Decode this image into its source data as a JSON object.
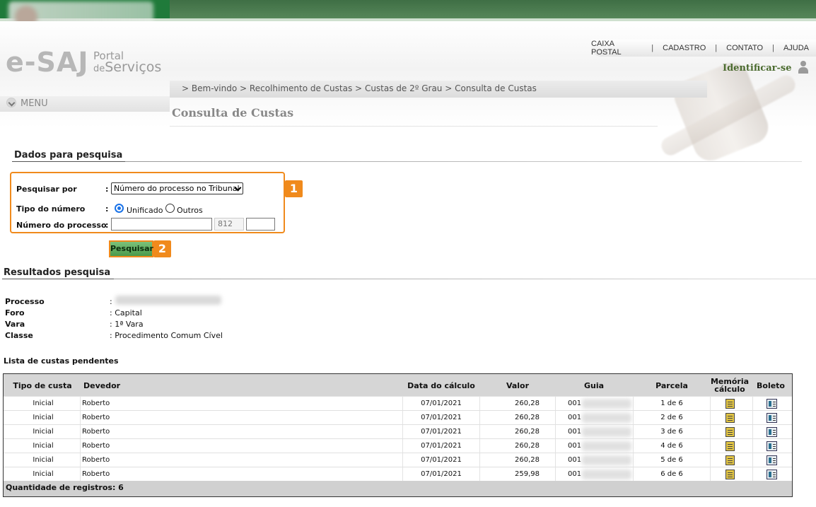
{
  "header": {
    "brand_esaj": "e-SAJ",
    "brand_portal": "Portal",
    "brand_de": "de",
    "brand_servicos": "Serviços",
    "nav": [
      "CAIXA POSTAL",
      "CADASTRO",
      "CONTATO",
      "AJUDA"
    ],
    "nav_separator": "|",
    "login_label": "Identificar-se",
    "menu_label": "MENU",
    "breadcrumb": [
      "Bem-vindo",
      "Recolhimento de Custas",
      "Custas de 2º Grau",
      "Consulta de Custas"
    ],
    "breadcrumb_sep": ">",
    "page_title": "Consulta de Custas"
  },
  "search": {
    "section_title": "Dados para pesquisa",
    "pesquisar_por_label": "Pesquisar por",
    "pesquisar_por_value": "Número do processo no Tribunal",
    "tipo_label": "Tipo do número",
    "tipo_options": [
      "Unificado",
      "Outros"
    ],
    "tipo_selected": "Unificado",
    "numero_label": "Número do processo",
    "numero_value": "",
    "numero_segment": "812",
    "numero_extra": "",
    "colon": ":",
    "button_label": "Pesquisar",
    "badge_1": "1",
    "badge_2": "2"
  },
  "results": {
    "section_title": "Resultados pesquisa",
    "fields": [
      {
        "label": "Processo",
        "value": ""
      },
      {
        "label": "Foro",
        "value": "Capital"
      },
      {
        "label": "Vara",
        "value": "1ª Vara"
      },
      {
        "label": "Classe",
        "value": "Procedimento Comum Cível"
      }
    ],
    "list_title": "Lista de custas pendentes"
  },
  "table": {
    "headers": {
      "tipo": "Tipo de custa",
      "devedor": "Devedor",
      "data": "Data do cálculo",
      "valor": "Valor",
      "guia": "Guia",
      "parcela": "Parcela",
      "memoria_1": "Memória",
      "memoria_2": "cálculo",
      "boleto": "Boleto"
    },
    "rows": [
      {
        "tipo": "Inicial",
        "devedor": "Roberto",
        "data": "07/01/2021",
        "valor": "260,28",
        "guia": "001",
        "parcela": "1 de 6"
      },
      {
        "tipo": "Inicial",
        "devedor": "Roberto",
        "data": "07/01/2021",
        "valor": "260,28",
        "guia": "001",
        "parcela": "2 de 6"
      },
      {
        "tipo": "Inicial",
        "devedor": "Roberto",
        "data": "07/01/2021",
        "valor": "260,28",
        "guia": "001",
        "parcela": "3 de 6"
      },
      {
        "tipo": "Inicial",
        "devedor": "Roberto",
        "data": "07/01/2021",
        "valor": "260,28",
        "guia": "001",
        "parcela": "4 de 6"
      },
      {
        "tipo": "Inicial",
        "devedor": "Roberto",
        "data": "07/01/2021",
        "valor": "260,28",
        "guia": "001",
        "parcela": "5 de 6"
      },
      {
        "tipo": "Inicial",
        "devedor": "Roberto",
        "data": "07/01/2021",
        "valor": "259,98",
        "guia": "001",
        "parcela": "6 de 6"
      }
    ],
    "footer": "Quantidade de registros: 6"
  },
  "icons": {
    "memoria": "calculation-memo-icon",
    "boleto": "boleto-icon",
    "user": "user-icon",
    "menu": "chevron-down-icon"
  },
  "colors": {
    "accent_highlight": "#f08a1c",
    "brand_green": "#1f7a3a",
    "login_green": "#4b6b2f",
    "button_green": "#5aa85a"
  }
}
